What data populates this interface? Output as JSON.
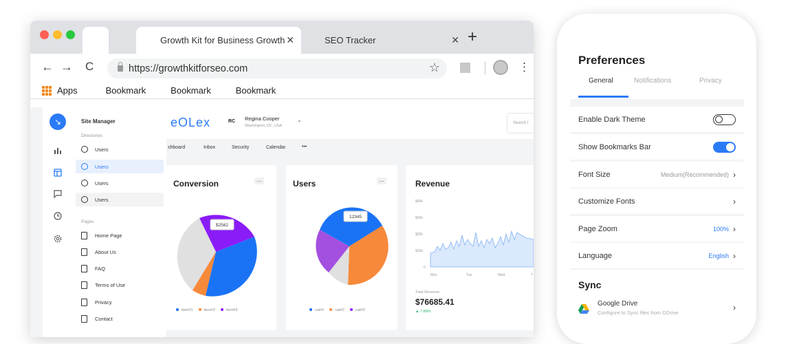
{
  "browser": {
    "tabs": [
      {
        "label": "Growth Kit for Business Growth"
      },
      {
        "label": "SEO Tracker"
      }
    ],
    "close_glyph": "✕",
    "new_tab_glyph": "+",
    "url": "https://growthkitforseo.com",
    "bookmarks_bar": {
      "apps_label": "Apps",
      "items": [
        "Bookmark",
        "Bookmark",
        "Bookmark"
      ]
    },
    "icons": {
      "back": "←",
      "forward": "→",
      "reload": "C",
      "star": "☆",
      "menu": "⋮"
    },
    "traffic_lights": [
      "#ff5f57",
      "#ffbd2e",
      "#28c840"
    ]
  },
  "dashboard": {
    "rail_icons": [
      "bar-chart-icon",
      "layout-icon",
      "chat-icon",
      "clock-icon",
      "settings-icon"
    ],
    "site_manager": {
      "title": "Site Manager",
      "directories_label": "Directories",
      "directory_items": [
        "Users",
        "Users",
        "Users",
        "Users"
      ],
      "pages_label": "Pages",
      "pages": [
        "Home Page",
        "About Us",
        "FAQ",
        "Terms of Use",
        "Privacy",
        "Contact"
      ]
    },
    "brand": "eOLex",
    "user": {
      "initials": "RC",
      "name": "Regina Cooper",
      "location": "Washington, DC, USA"
    },
    "search_placeholder": "Search t",
    "nav": [
      "shboard",
      "Inbox",
      "Security",
      "Calendar",
      "•••"
    ],
    "cards": {
      "conversion": {
        "title": "Conversion",
        "tooltip": "$2562",
        "legend": [
          "item#1",
          "item#2",
          "item#3"
        ]
      },
      "users": {
        "title": "Users",
        "tooltip": "12345",
        "legend": [
          "cat#1",
          "cat#2",
          "cat#3"
        ]
      },
      "revenue": {
        "title": "Revenue",
        "total_label": "Total Revenue",
        "total_value": "$76685.41",
        "change": "▲ 7.89%",
        "y_ticks": [
          "$40k",
          "$30k",
          "$20k",
          "$10k",
          "0"
        ],
        "x_ticks": [
          "Mon",
          "Tue",
          "Wed",
          "T"
        ]
      }
    },
    "colors": {
      "purple": "#8a1cf7",
      "orange": "#f7893a",
      "blue": "#1a73f5",
      "grey": "#e0e0e0",
      "accent": "#2b7bf6"
    }
  },
  "preferences": {
    "title": "Preferences",
    "tabs": [
      "General",
      "Notifications",
      "Privacy"
    ],
    "rows": [
      {
        "label": "Enable Dark Theme",
        "toggle": false
      },
      {
        "label": "Show Bookmarks Bar",
        "toggle": true
      },
      {
        "label": "Font Size",
        "value": "Medium(Recommended)"
      },
      {
        "label": "Customize Fonts",
        "value": ""
      },
      {
        "label": "Page Zoom",
        "value": "100%"
      },
      {
        "label": "Language",
        "value": "English"
      }
    ],
    "sync_title": "Sync",
    "google_drive": {
      "title": "Google Drive",
      "subtitle": "Configure to Sync files from GDrive"
    }
  },
  "chart_data": [
    {
      "type": "pie",
      "title": "Conversion",
      "labels": [
        "item#1",
        "item#2",
        "item#3"
      ],
      "values": [
        30,
        40,
        20,
        10
      ]
    },
    {
      "type": "pie",
      "title": "Users",
      "labels": [
        "cat#1",
        "cat#2",
        "cat#3"
      ],
      "values": [
        25,
        50,
        15,
        10
      ]
    },
    {
      "type": "area",
      "title": "Revenue",
      "x": [
        "Mon",
        "Tue",
        "Wed",
        "T"
      ],
      "ylim": [
        0,
        40000
      ]
    }
  ]
}
